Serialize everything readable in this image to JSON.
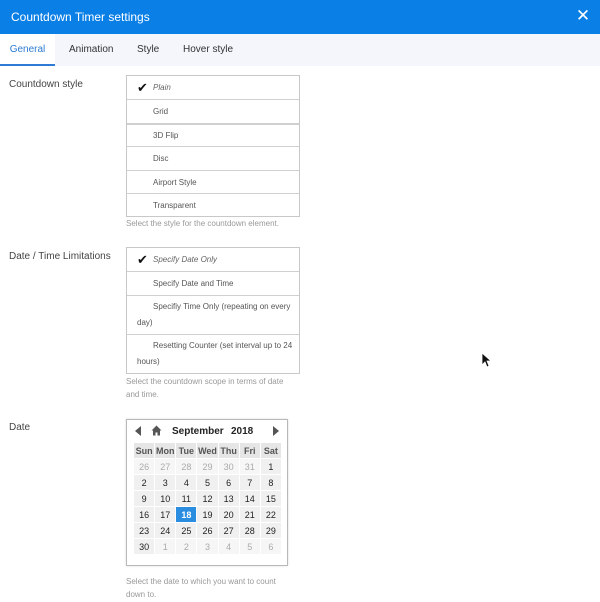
{
  "window": {
    "title": "Countdown Timer settings",
    "close_icon": "close-icon"
  },
  "tabs": [
    {
      "label": "General",
      "active": true
    },
    {
      "label": "Animation",
      "active": false
    },
    {
      "label": "Style",
      "active": false
    },
    {
      "label": "Hover style",
      "active": false
    }
  ],
  "countdown_style": {
    "label": "Countdown style",
    "options": [
      "Plain",
      "Grid",
      "3D Flip",
      "Disc",
      "Airport Style",
      "Transparent"
    ],
    "selected": "Plain",
    "help": "Select the style for the countdown element."
  },
  "date_time_limits": {
    "label": "Date / Time Limitations",
    "options": [
      "Specify Date Only",
      "Specify Date and Time",
      "Specifiy Time Only (repeating on every day)",
      "Resetting Counter (set interval up to 24 hours)"
    ],
    "selected": "Specify Date Only",
    "help": "Select the countdown scope in terms of date and time."
  },
  "date": {
    "label": "Date",
    "calendar": {
      "month": "September",
      "year": "2018",
      "weekdays": [
        "Sun",
        "Mon",
        "Tue",
        "Wed",
        "Thu",
        "Fri",
        "Sat"
      ],
      "weeks": [
        [
          "26",
          "27",
          "28",
          "29",
          "30",
          "31",
          "1"
        ],
        [
          "2",
          "3",
          "4",
          "5",
          "6",
          "7",
          "8"
        ],
        [
          "9",
          "10",
          "11",
          "12",
          "13",
          "14",
          "15"
        ],
        [
          "16",
          "17",
          "18",
          "19",
          "20",
          "21",
          "22"
        ],
        [
          "23",
          "24",
          "25",
          "26",
          "27",
          "28",
          "29"
        ],
        [
          "30",
          "1",
          "2",
          "3",
          "4",
          "5",
          "6"
        ]
      ],
      "selected_day": "18",
      "selected_color": "#2a8de0"
    },
    "help": "Select the date to which you want to count down to."
  },
  "colors": {
    "titlebar": "#0a7fe6",
    "active_tab": "#2d7bd4"
  }
}
